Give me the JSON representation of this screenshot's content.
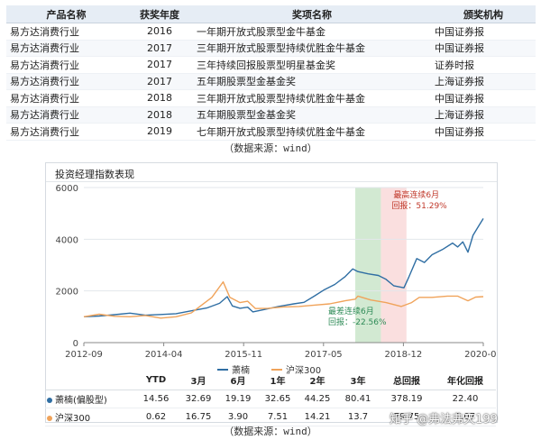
{
  "awards": {
    "headers": [
      "产品名称",
      "获奖年度",
      "奖项名称",
      "颁奖机构"
    ],
    "rows": [
      [
        "易方达消费行业",
        "2016",
        "一年期开放式股票型金牛基金",
        "中国证券报"
      ],
      [
        "易方达消费行业",
        "2017",
        "三年期开放式股票型持续优胜金牛基金",
        "中国证券报"
      ],
      [
        "易方达消费行业",
        "2017",
        "三年持续回报股票型明星基金奖",
        "证券时报"
      ],
      [
        "易方达消费行业",
        "2017",
        "五年期股票型金基金奖",
        "上海证券报"
      ],
      [
        "易方达消费行业",
        "2018",
        "三年期开放式股票型持续优胜金牛基金",
        "中国证券报"
      ],
      [
        "易方达消费行业",
        "2018",
        "五年期股票型金基金奖",
        "上海证券报"
      ],
      [
        "易方达消费行业",
        "2019",
        "七年期开放式股票型持续优胜金牛基金",
        "中国证券报"
      ]
    ]
  },
  "source_note": "（数据来源：wind）",
  "panel_title": "投资经理指数表现",
  "chart_data": {
    "type": "line",
    "title": "投资经理指数表现",
    "xlabel": "",
    "ylabel": "",
    "ylim": [
      0,
      6000
    ],
    "y_ticks": [
      "0",
      "2000",
      "4000",
      "6000"
    ],
    "x_ticks": [
      "2012-09",
      "2014-04",
      "2015-11",
      "2017-05",
      "2018-12",
      "2020-06"
    ],
    "grid": true,
    "legend_position": "bottom",
    "series": [
      {
        "name": "萧楠",
        "color": "#2f6ea3",
        "points": [
          [
            2012.7,
            1000
          ],
          [
            2013.0,
            1030
          ],
          [
            2013.3,
            1080
          ],
          [
            2013.6,
            1140
          ],
          [
            2013.9,
            1060
          ],
          [
            2014.2,
            1090
          ],
          [
            2014.5,
            1120
          ],
          [
            2014.8,
            1230
          ],
          [
            2015.1,
            1340
          ],
          [
            2015.35,
            1520
          ],
          [
            2015.5,
            1780
          ],
          [
            2015.6,
            1420
          ],
          [
            2015.75,
            1330
          ],
          [
            2015.9,
            1370
          ],
          [
            2016.0,
            1190
          ],
          [
            2016.2,
            1270
          ],
          [
            2016.5,
            1400
          ],
          [
            2016.8,
            1500
          ],
          [
            2017.0,
            1560
          ],
          [
            2017.2,
            1800
          ],
          [
            2017.4,
            2050
          ],
          [
            2017.6,
            2250
          ],
          [
            2017.8,
            2550
          ],
          [
            2017.95,
            2850
          ],
          [
            2018.05,
            2750
          ],
          [
            2018.25,
            2660
          ],
          [
            2018.45,
            2600
          ],
          [
            2018.6,
            2450
          ],
          [
            2018.75,
            2200
          ],
          [
            2018.95,
            2120
          ],
          [
            2019.05,
            2550
          ],
          [
            2019.2,
            3250
          ],
          [
            2019.35,
            3100
          ],
          [
            2019.5,
            3400
          ],
          [
            2019.7,
            3600
          ],
          [
            2019.9,
            3850
          ],
          [
            2020.0,
            3700
          ],
          [
            2020.1,
            3900
          ],
          [
            2020.2,
            3500
          ],
          [
            2020.3,
            4150
          ],
          [
            2020.42,
            4550
          ],
          [
            2020.5,
            4800
          ]
        ]
      },
      {
        "name": "沪深300",
        "color": "#f0a35a",
        "points": [
          [
            2012.7,
            1000
          ],
          [
            2013.0,
            1100
          ],
          [
            2013.3,
            1020
          ],
          [
            2013.6,
            1000
          ],
          [
            2013.9,
            1050
          ],
          [
            2014.2,
            950
          ],
          [
            2014.5,
            1000
          ],
          [
            2014.8,
            1150
          ],
          [
            2015.0,
            1450
          ],
          [
            2015.2,
            1750
          ],
          [
            2015.42,
            2350
          ],
          [
            2015.55,
            1750
          ],
          [
            2015.75,
            1550
          ],
          [
            2015.9,
            1600
          ],
          [
            2016.05,
            1320
          ],
          [
            2016.3,
            1330
          ],
          [
            2016.6,
            1380
          ],
          [
            2016.9,
            1400
          ],
          [
            2017.2,
            1450
          ],
          [
            2017.5,
            1500
          ],
          [
            2017.8,
            1620
          ],
          [
            2018.0,
            1680
          ],
          [
            2018.05,
            1800
          ],
          [
            2018.3,
            1650
          ],
          [
            2018.6,
            1550
          ],
          [
            2018.9,
            1400
          ],
          [
            2019.1,
            1550
          ],
          [
            2019.25,
            1750
          ],
          [
            2019.5,
            1750
          ],
          [
            2019.8,
            1800
          ],
          [
            2020.0,
            1800
          ],
          [
            2020.2,
            1620
          ],
          [
            2020.35,
            1760
          ],
          [
            2020.5,
            1780
          ]
        ]
      }
    ],
    "annotations": [
      {
        "type": "band",
        "label": "最差连续6月",
        "value_text": "回报：-22.56%",
        "color": "#7fbf7f",
        "x_range": [
          2018.0,
          2018.5
        ],
        "text_color": "#2e8b57"
      },
      {
        "type": "band",
        "label": "最高连续6月",
        "value_text": "回报：51.29%",
        "color": "#f2a3a3",
        "x_range": [
          2018.5,
          2019.0
        ],
        "text_color": "#c0392b"
      }
    ]
  },
  "performance": {
    "headers": [
      "",
      "YTD",
      "3月",
      "6月",
      "1年",
      "2年",
      "3年",
      "总回报",
      "年化回报"
    ],
    "rows": [
      {
        "name": "萧楠(偏股型)",
        "color": "#2f6ea3",
        "values": [
          "14.56",
          "32.69",
          "19.19",
          "32.65",
          "44.25",
          "80.41",
          "378.19",
          "22.40"
        ]
      },
      {
        "name": "沪深300",
        "color": "#f0a35a",
        "values": [
          "0.62",
          "16.75",
          "3.90",
          "7.51",
          "14.21",
          "13.7",
          "79.75",
          "7.07"
        ]
      }
    ]
  },
  "source_note_2": "（数据来源：wind）",
  "watermark": "知乎 @弗法弗天199"
}
